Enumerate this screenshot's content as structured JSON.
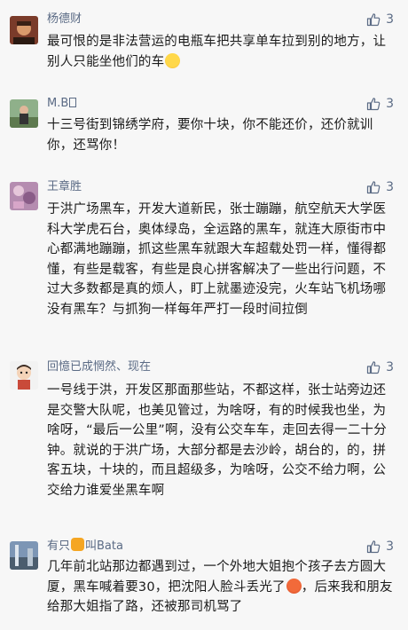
{
  "comments": [
    {
      "username": "杨德财",
      "likes": "3",
      "text": "最可恨的是非法营运的电瓶车把共享单车拉到别的地方，让别人只能坐他们的车",
      "emoji": "crying-laughing-emoji"
    },
    {
      "username": "M.B",
      "likes": "3",
      "text": "十三号街到锦绣学府，要你十块，你不能还价，还价就训你，还骂你！"
    },
    {
      "username": "王章胜",
      "likes": "3",
      "text": "于洪广场黑车，开发大道新民，张士蹦蹦，航空航天大学医科大学虎石台，奥体绿岛，全运路的黑车，就连大原街市中心都满地蹦蹦，抓这些黑车就跟大车超载处罚一样，懂得都懂，有些是载客，有些是良心拼客解决了一些出行问题，不过大多数都是真的烦人，盯上就墨迹没完，火车站飞机场哪没有黑车？与抓狗一样每年严打一段时间拉倒"
    },
    {
      "username": "回憶已成惘然、现在",
      "likes": "3",
      "text": "一号线于洪，开发区那面那些站，不都这样，张士站旁边还是交警大队呢，也美见管过，为啥呀，有的时候我也坐，为啥呀，“最后一公里”啊，没有公交车车，走回去得一二十分钟。就说的于洪广场，大部分都是去沙岭，胡台的，的，拼客五块，十块的，而且超级多，为啥呀，公交不给力啊，公交给力谁爱坐黑车啊"
    },
    {
      "username_prefix": "有只",
      "username_suffix": "叫Bata",
      "username_icon": "cat-icon",
      "likes": "3",
      "text": "几年前北站那边都遇到过，一个外地大姐抱个孩子去方圆大厦，黑车喊着要30，把沈阳人脸斗丢光了",
      "emoji": "angry-face-emoji",
      "text_after": "，后来我和朋友给那大姐指了路，还被那司机骂了"
    }
  ],
  "colors": {
    "background": "#f7f7f7",
    "username": "#5b6b85",
    "text": "#1b1b1b"
  }
}
